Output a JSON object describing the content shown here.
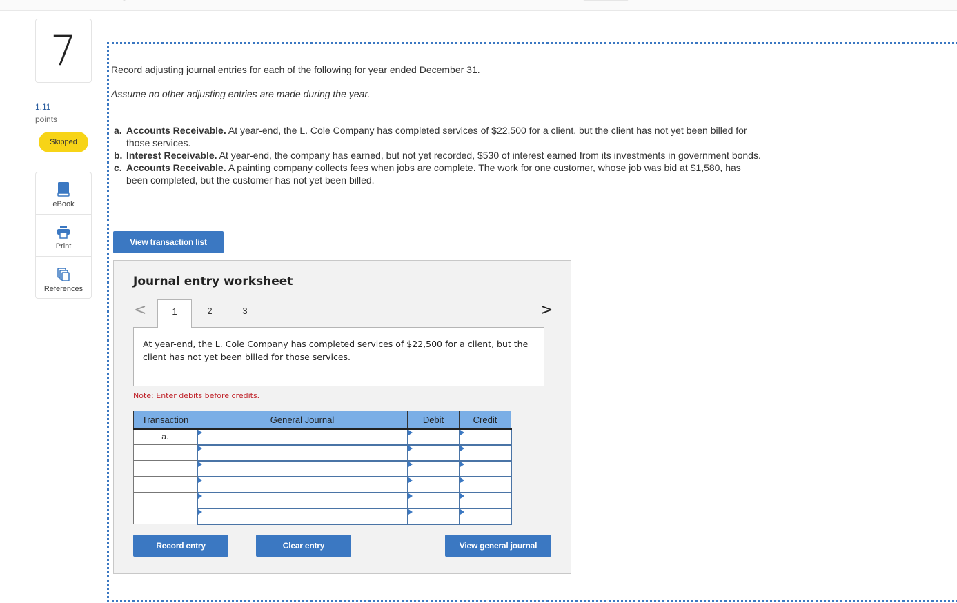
{
  "question": {
    "number": "7",
    "points_value": "1.11",
    "points_label": "points",
    "status": "Skipped"
  },
  "tools": [
    {
      "label": "eBook",
      "icon": "book-icon"
    },
    {
      "label": "Print",
      "icon": "printer-icon"
    },
    {
      "label": "References",
      "icon": "copy-icon"
    }
  ],
  "prompt": {
    "intro": "Record adjusting journal entries for each of the following for year ended December 31.",
    "assume": "Assume no other adjusting entries are made during the year.",
    "items": [
      {
        "marker": "a.",
        "title": "Accounts Receivable.",
        "text": " At year-end, the L. Cole Company has completed services of $22,500 for a client, but the client has not yet been billed for those services."
      },
      {
        "marker": "b.",
        "title": "Interest Receivable.",
        "text": " At year-end, the company has earned, but not yet recorded, $530 of interest earned from its investments in government bonds."
      },
      {
        "marker": "c.",
        "title": "Accounts Receivable.",
        "text": " A painting company collects fees when jobs are complete. The work for one customer, whose job was bid at $1,580, has been completed, but the customer has not yet been billed."
      }
    ]
  },
  "buttons": {
    "view_transaction_list": "View transaction list",
    "record_entry": "Record entry",
    "clear_entry": "Clear entry",
    "view_general_journal": "View general journal"
  },
  "worksheet": {
    "title": "Journal entry worksheet",
    "prev": "<",
    "next": ">",
    "tabs": [
      "1",
      "2",
      "3"
    ],
    "active_tab": "1",
    "description": "At year-end, the L. Cole Company has completed services of $22,500 for a client, but the client has not yet been billed for those services.",
    "note": "Note: Enter debits before credits.",
    "columns": [
      "Transaction",
      "General Journal",
      "Debit",
      "Credit"
    ],
    "rows": [
      {
        "transaction": "a.",
        "account": "",
        "debit": "",
        "credit": ""
      },
      {
        "transaction": "",
        "account": "",
        "debit": "",
        "credit": ""
      },
      {
        "transaction": "",
        "account": "",
        "debit": "",
        "credit": ""
      },
      {
        "transaction": "",
        "account": "",
        "debit": "",
        "credit": ""
      },
      {
        "transaction": "",
        "account": "",
        "debit": "",
        "credit": ""
      },
      {
        "transaction": "",
        "account": "",
        "debit": "",
        "credit": ""
      }
    ]
  }
}
